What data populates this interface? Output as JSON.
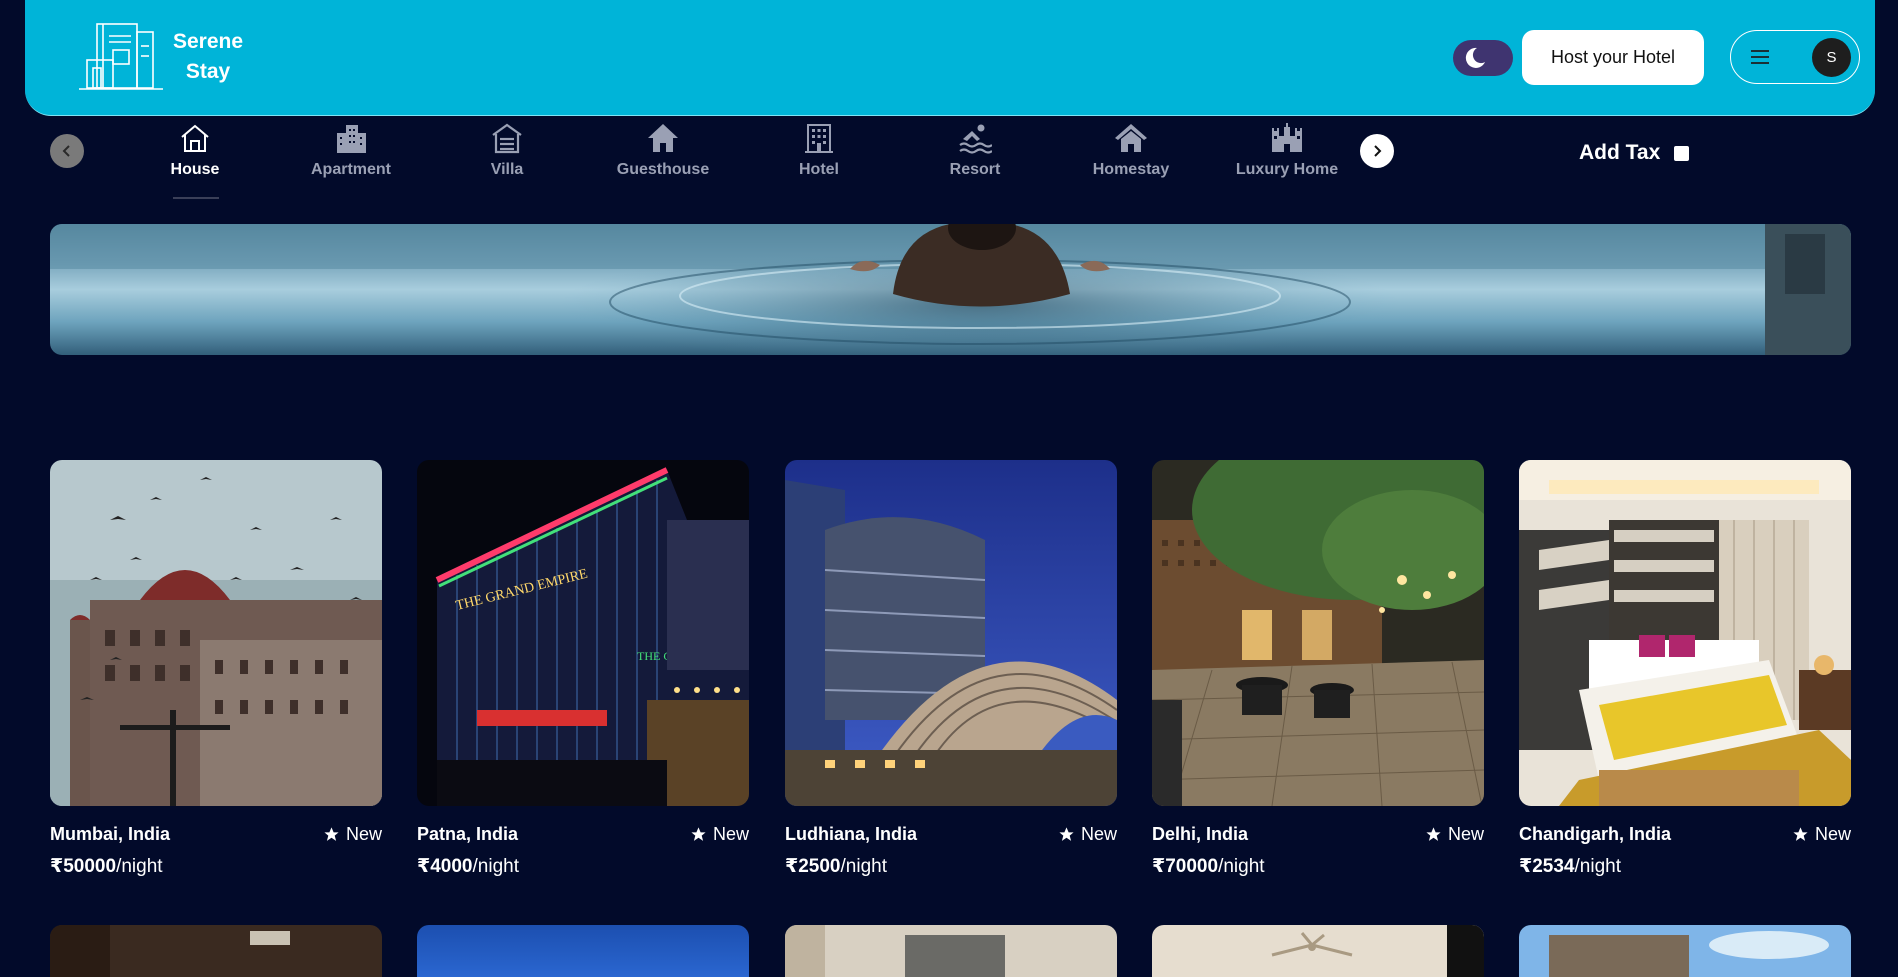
{
  "header": {
    "logo_line1": "Serene",
    "logo_line2": "Stay",
    "host_button": "Host your Hotel",
    "avatar_initial": "S",
    "accent_color": "#00b4d8"
  },
  "categories": [
    {
      "label": "House",
      "icon": "house-icon",
      "active": true
    },
    {
      "label": "Apartment",
      "icon": "apartment-icon"
    },
    {
      "label": "Villa",
      "icon": "villa-icon"
    },
    {
      "label": "Guesthouse",
      "icon": "guesthouse-icon"
    },
    {
      "label": "Hotel",
      "icon": "hotel-icon"
    },
    {
      "label": "Resort",
      "icon": "resort-icon"
    },
    {
      "label": "Homestay",
      "icon": "homestay-icon"
    },
    {
      "label": "Luxury Home",
      "icon": "luxury-home-icon"
    }
  ],
  "filter": {
    "add_tax_label": "Add Tax"
  },
  "listings": [
    {
      "location": "Mumbai, India",
      "badge": "New",
      "price": "₹50000",
      "unit": "/night"
    },
    {
      "location": "Patna, India",
      "badge": "New",
      "price": "₹4000",
      "unit": "/night"
    },
    {
      "location": "Ludhiana, India",
      "badge": "New",
      "price": "₹2500",
      "unit": "/night"
    },
    {
      "location": "Delhi, India",
      "badge": "New",
      "price": "₹70000",
      "unit": "/night"
    },
    {
      "location": "Chandigarh, India",
      "badge": "New",
      "price": "₹2534",
      "unit": "/night"
    }
  ]
}
